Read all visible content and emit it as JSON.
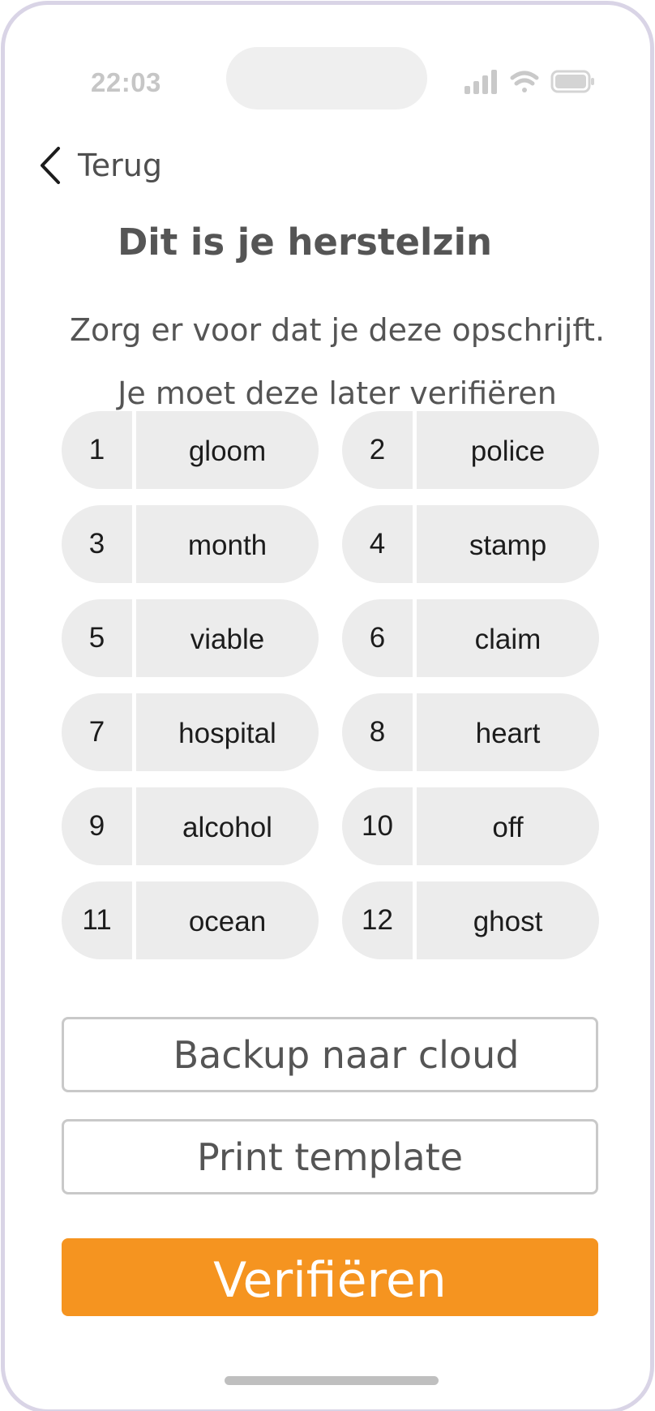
{
  "status_bar": {
    "time": "22:03"
  },
  "nav": {
    "back_label": "Terug"
  },
  "header": {
    "title": "Dit is je herstelzin",
    "subtitle_line1": "Zorg er voor dat je deze opschrijft.",
    "subtitle_line2": "Je moet deze later verifiëren"
  },
  "words": [
    {
      "index": "1",
      "word": "gloom"
    },
    {
      "index": "2",
      "word": "police"
    },
    {
      "index": "3",
      "word": "month"
    },
    {
      "index": "4",
      "word": "stamp"
    },
    {
      "index": "5",
      "word": "viable"
    },
    {
      "index": "6",
      "word": "claim"
    },
    {
      "index": "7",
      "word": "hospital"
    },
    {
      "index": "8",
      "word": "heart"
    },
    {
      "index": "9",
      "word": "alcohol"
    },
    {
      "index": "10",
      "word": "off"
    },
    {
      "index": "11",
      "word": "ocean"
    },
    {
      "index": "12",
      "word": "ghost"
    }
  ],
  "actions": {
    "backup_label": "Backup naar cloud",
    "print_label": "Print template",
    "verify_label": "Verifiëren"
  },
  "colors": {
    "accent": "#f59420",
    "pill_background": "#ececec",
    "frame": "#d9d4e6"
  },
  "icons": {
    "back": "chevron-left-icon",
    "signal": "signal-icon",
    "wifi": "wifi-icon",
    "battery": "battery-icon"
  }
}
